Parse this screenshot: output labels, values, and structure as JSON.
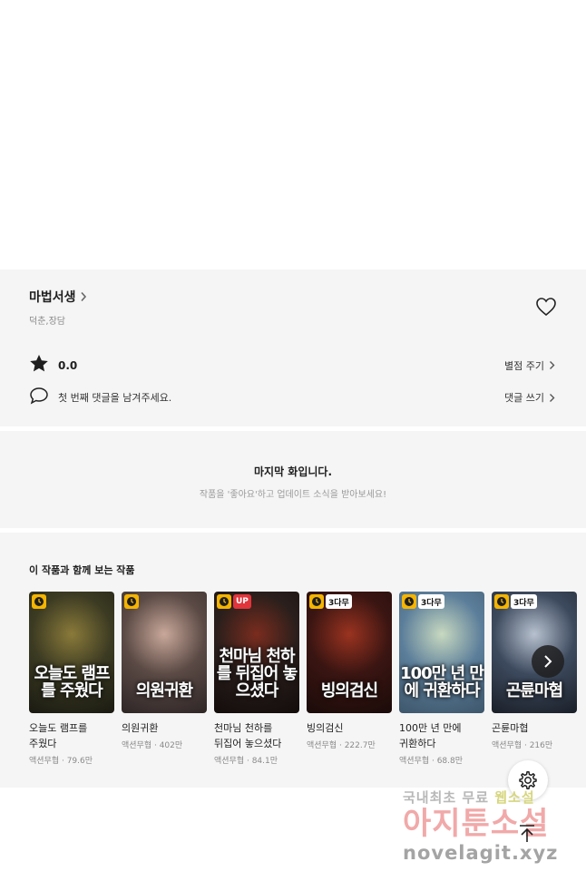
{
  "work": {
    "title": "마법서생",
    "author": "덕춘,장담"
  },
  "rating": {
    "value": "0.0",
    "action_label": "별점 주기"
  },
  "comment": {
    "prompt": "첫 번째 댓글을 남겨주세요.",
    "action_label": "댓글 쓰기"
  },
  "last_episode": {
    "title": "마지막 화입니다.",
    "subtitle": "작품을 '좋아요'하고 업데이트 소식을 받아보세요!"
  },
  "recommendations": {
    "heading": "이 작품과 함께 보는 작품",
    "items": [
      {
        "title": "오늘도 램프를 주웠다",
        "meta": "액션무협 · 79.6만",
        "badge": "",
        "cover_text": "오늘도 램프를 주웠다",
        "colors": [
          "#3b3a22",
          "#8a7a3a",
          "#1a1a12"
        ]
      },
      {
        "title": "의원귀환",
        "meta": "액션무협 · 402만",
        "badge": "",
        "cover_text": "의원귀환",
        "colors": [
          "#5b4a45",
          "#c9a89a",
          "#2e2626"
        ]
      },
      {
        "title": "천마님 천하를 뒤집어 놓으셨다",
        "meta": "액션무협 · 84.1만",
        "badge": "UP",
        "cover_text": "천마님 천하를 뒤집어 놓으셨다",
        "colors": [
          "#2a1f1c",
          "#7a2c1e",
          "#120c0b"
        ]
      },
      {
        "title": "빙의검신",
        "meta": "액션무협 · 222.7만",
        "badge": "3다무",
        "cover_text": "빙의검신",
        "colors": [
          "#3a1512",
          "#9a3320",
          "#1a0b09"
        ]
      },
      {
        "title": "100만 년 만에 귀환하다",
        "meta": "액션무협 · 68.8만",
        "badge": "3다무",
        "cover_text": "100만 년 만에 귀환하다",
        "colors": [
          "#5c7e9a",
          "#c8d9c0",
          "#3d566b"
        ]
      },
      {
        "title": "곤륜마협",
        "meta": "액션무협 · 216만",
        "badge": "3다무",
        "cover_text": "곤륜마협",
        "colors": [
          "#3d4a5e",
          "#b7c1cf",
          "#1a1f28"
        ]
      }
    ]
  },
  "watermark": {
    "line1_a": "국내최초 무료 ",
    "line1_b": "웹소설",
    "line2": "아지툰소설",
    "line3": "novelagit.xyz"
  },
  "icons": {
    "title_chevron": "chevron-right-icon",
    "like": "heart-icon",
    "rating": "star-icon",
    "comment": "speech-bubble-icon",
    "settings": "gear-icon",
    "scroll_top": "arrow-up-icon",
    "next": "chevron-right-icon",
    "free_badge": "clock-icon"
  },
  "colors": {
    "panel_bg": "#f5f5f5",
    "text_primary": "#1e1e1e",
    "text_secondary": "#8a8a8a",
    "badge_clock": "#f4b400",
    "badge_up": "#e0353b"
  }
}
